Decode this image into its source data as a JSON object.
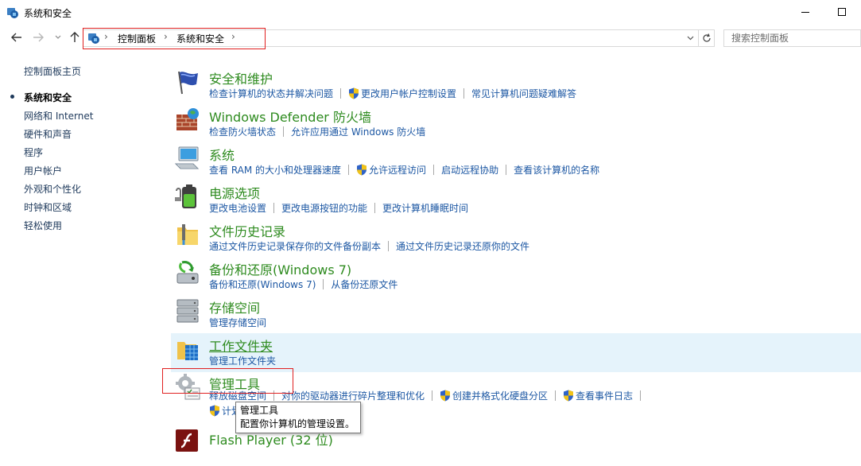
{
  "window": {
    "title": "系统和安全"
  },
  "address": {
    "crumbs": [
      "控制面板",
      "系统和安全"
    ],
    "search_placeholder": "搜索控制面板"
  },
  "sidebar": {
    "items": [
      {
        "label": "控制面板主页",
        "current": false
      },
      {
        "label": "系统和安全",
        "current": true
      },
      {
        "label": "网络和 Internet",
        "current": false
      },
      {
        "label": "硬件和声音",
        "current": false
      },
      {
        "label": "程序",
        "current": false
      },
      {
        "label": "用户帐户",
        "current": false
      },
      {
        "label": "外观和个性化",
        "current": false
      },
      {
        "label": "时钟和区域",
        "current": false
      },
      {
        "label": "轻松使用",
        "current": false
      }
    ]
  },
  "categories": [
    {
      "title": "安全和维护",
      "links": [
        "检查计算机的状态并解决问题",
        "更改用户帐户控制设置",
        "常见计算机问题疑难解答"
      ]
    },
    {
      "title": "Windows Defender 防火墙",
      "links": [
        "检查防火墙状态",
        "允许应用通过 Windows 防火墙"
      ]
    },
    {
      "title": "系统",
      "links": [
        "查看 RAM 的大小和处理器速度",
        "允许远程访问",
        "启动远程协助",
        "查看该计算机的名称"
      ]
    },
    {
      "title": "电源选项",
      "links": [
        "更改电池设置",
        "更改电源按钮的功能",
        "更改计算机睡眠时间"
      ]
    },
    {
      "title": "文件历史记录",
      "links": [
        "通过文件历史记录保存你的文件备份副本",
        "通过文件历史记录还原你的文件"
      ]
    },
    {
      "title": "备份和还原(Windows 7)",
      "links": [
        "备份和还原(Windows 7)",
        "从备份还原文件"
      ]
    },
    {
      "title": "存储空间",
      "links": [
        "管理存储空间"
      ]
    },
    {
      "title": "工作文件夹",
      "links": [
        "管理工作文件夹"
      ]
    },
    {
      "title": "管理工具",
      "links": [
        "释放磁盘空间",
        "对你的驱动器进行碎片整理和优化",
        "创建并格式化硬盘分区",
        "查看事件日志",
        "计划任务"
      ]
    },
    {
      "title": "Flash Player (32 位)",
      "links": []
    }
  ],
  "tooltip": {
    "title": "管理工具",
    "description": "配置你计算机的管理设置。"
  },
  "colors": {
    "link": "#1c57a3",
    "category_title": "#2e8b1f",
    "hover_bg": "#e5f3fb",
    "highlight": "#e02020"
  }
}
